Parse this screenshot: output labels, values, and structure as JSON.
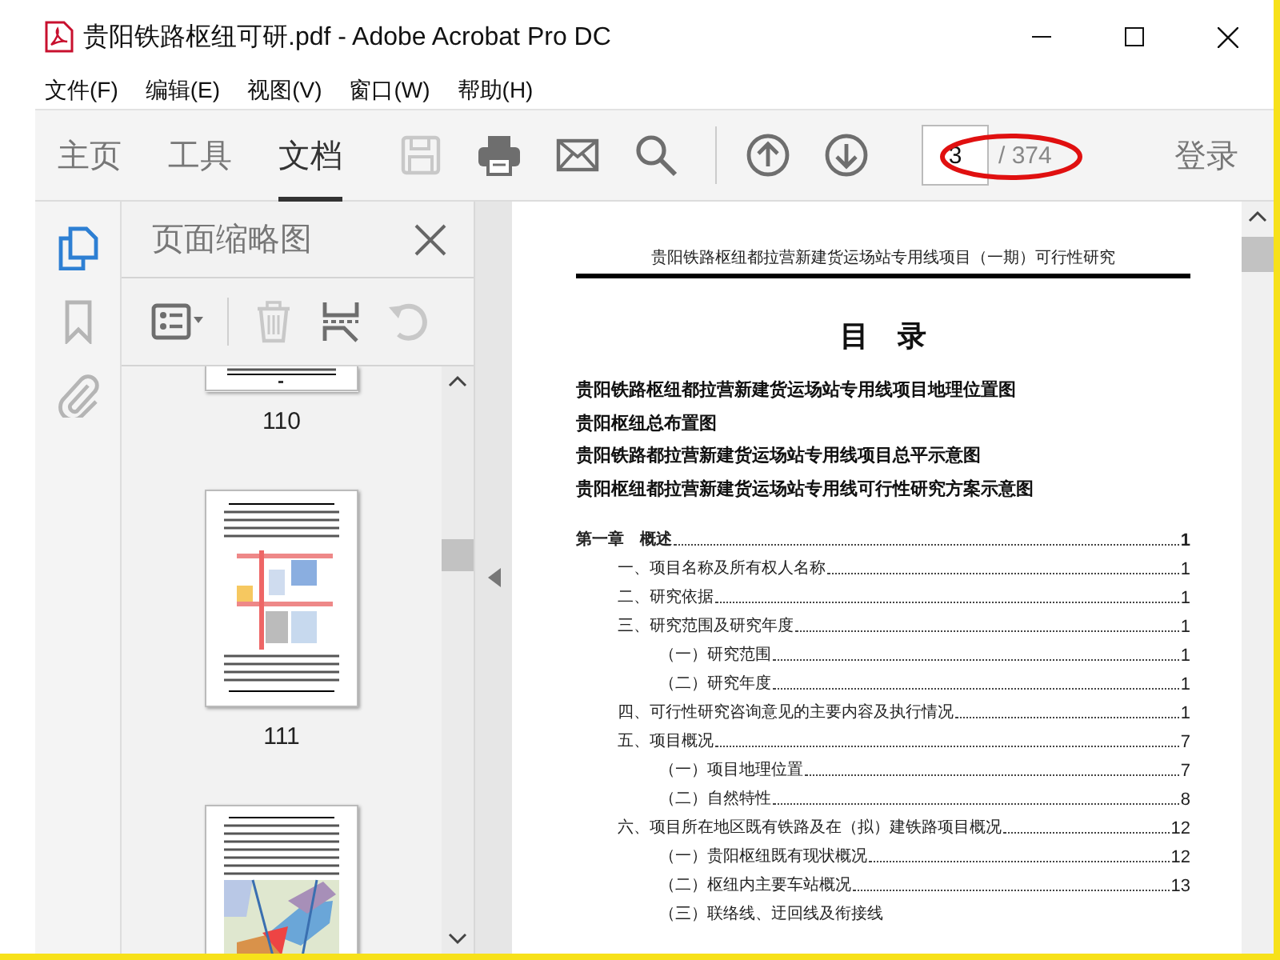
{
  "window": {
    "title": "贵阳铁路枢纽可研.pdf - Adobe Acrobat Pro DC"
  },
  "menu": [
    "文件(F)",
    "编辑(E)",
    "视图(V)",
    "窗口(W)",
    "帮助(H)"
  ],
  "toolbar": {
    "tabs": [
      {
        "label": "主页",
        "selected": false
      },
      {
        "label": "工具",
        "selected": false
      },
      {
        "label": "文档",
        "selected": true
      }
    ],
    "tools": [
      {
        "kind": "save",
        "disabled": true
      },
      {
        "kind": "print",
        "disabled": false
      },
      {
        "kind": "mail",
        "disabled": false
      },
      {
        "kind": "search",
        "disabled": false
      }
    ],
    "page_field": {
      "value": "3"
    },
    "page_total": "/ 374",
    "sign_in": "登录"
  },
  "rail": [
    {
      "kind": "pages",
      "selected": true
    },
    {
      "kind": "bookmark",
      "selected": false
    },
    {
      "kind": "attachment",
      "selected": false
    }
  ],
  "side_panel": {
    "title": "页面缩略图",
    "tools": [
      {
        "kind": "options",
        "disabled": false
      },
      {
        "kind": "delete",
        "disabled": true
      },
      {
        "kind": "extract",
        "disabled": false
      },
      {
        "kind": "rotate",
        "disabled": true
      }
    ],
    "thumbnails": [
      {
        "kind": "text",
        "label": "110"
      },
      {
        "kind": "plan",
        "label": "111"
      },
      {
        "kind": "map"
      }
    ]
  },
  "document": {
    "header": "贵阳铁路枢纽都拉营新建货运场站专用线项目（一期）可行性研究",
    "title": "目　录",
    "figures": [
      "贵阳铁路枢纽都拉营新建货运场站专用线项目地理位置图",
      "贵阳枢纽总布置图",
      "贵阳铁路都拉营新建货运场站专用线项目总平示意图",
      "贵阳枢纽都拉营新建货运场站专用线可行性研究方案示意图"
    ],
    "toc": [
      {
        "text": "第一章　概述",
        "page": "1",
        "children": [
          {
            "text": "一、项目名称及所有权人名称",
            "page": "1"
          },
          {
            "text": "二、研究依据",
            "page": "1"
          },
          {
            "text": "三、研究范围及研究年度",
            "page": "1",
            "children": [
              {
                "text": "（一）研究范围",
                "page": "1"
              },
              {
                "text": "（二）研究年度",
                "page": "1"
              }
            ]
          },
          {
            "text": "四、可行性研究咨询意见的主要内容及执行情况",
            "page": "1"
          },
          {
            "text": "五、项目概况",
            "page": "7",
            "children": [
              {
                "text": "（一）项目地理位置",
                "page": "7"
              },
              {
                "text": "（二）自然特性",
                "page": "8"
              }
            ]
          },
          {
            "text": "六、项目所在地区既有铁路及在（拟）建铁路项目概况",
            "page": "12",
            "children": [
              {
                "text": "（一）贵阳枢纽既有现状概况",
                "page": "12"
              },
              {
                "text": "（二）枢纽内主要车站概况",
                "page": "13"
              },
              {
                "text": "（三）联络线、迂回线及衔接线"
              }
            ]
          }
        ]
      }
    ]
  }
}
